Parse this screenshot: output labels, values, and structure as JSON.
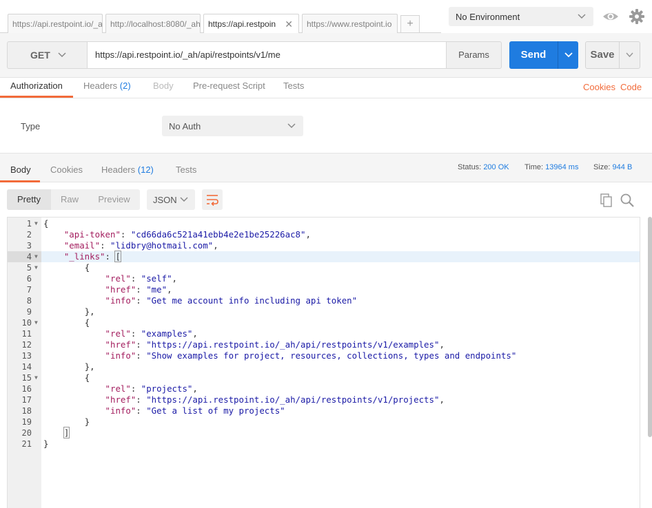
{
  "tabs": [
    {
      "label": "https://api.restpoint.io/_a",
      "active": false
    },
    {
      "label": "http://localhost:8080/_ah",
      "active": false
    },
    {
      "label": "https://api.restpoin",
      "active": true
    },
    {
      "label": "https://www.restpoint.io",
      "active": false
    }
  ],
  "tab_add": "+",
  "environment": {
    "selected": "No Environment"
  },
  "request": {
    "method": "GET",
    "url": "https://api.restpoint.io/_ah/api/restpoints/v1/me",
    "params_label": "Params",
    "send_label": "Send",
    "save_label": "Save"
  },
  "request_tabs": {
    "authorization": "Authorization",
    "headers": "Headers",
    "headers_count": "(2)",
    "body": "Body",
    "prerequest": "Pre-request Script",
    "tests": "Tests",
    "cookies_link": "Cookies",
    "code_link": "Code"
  },
  "auth": {
    "type_label": "Type",
    "type_value": "No Auth"
  },
  "response_tabs": {
    "body": "Body",
    "cookies": "Cookies",
    "headers": "Headers",
    "headers_count": "(12)",
    "tests": "Tests"
  },
  "response_meta": {
    "status_label": "Status:",
    "status_value": "200 OK",
    "time_label": "Time:",
    "time_value": "13964 ms",
    "size_label": "Size:",
    "size_value": "944 B"
  },
  "view": {
    "modes": [
      "Pretty",
      "Raw",
      "Preview"
    ],
    "active_mode": "Pretty",
    "format": "JSON"
  },
  "code_lines": [
    {
      "n": "1",
      "fold": true,
      "text": "{"
    },
    {
      "n": "2",
      "indent": 1,
      "key": "\"api-token\"",
      "value": "\"cd66da6c521a41ebb4e2e1be25226ac8\"",
      "tail": ","
    },
    {
      "n": "3",
      "indent": 1,
      "key": "\"email\"",
      "value": "\"lidbry@hotmail.com\"",
      "tail": ","
    },
    {
      "n": "4",
      "fold": true,
      "hl": true,
      "indent": 1,
      "key": "\"_links\"",
      "open": "["
    },
    {
      "n": "5",
      "fold": true,
      "indent": 2,
      "text": "{"
    },
    {
      "n": "6",
      "indent": 3,
      "key": "\"rel\"",
      "value": "\"self\"",
      "tail": ","
    },
    {
      "n": "7",
      "indent": 3,
      "key": "\"href\"",
      "value": "\"me\"",
      "tail": ","
    },
    {
      "n": "8",
      "indent": 3,
      "key": "\"info\"",
      "value": "\"Get me account info including api token\"",
      "tail": ""
    },
    {
      "n": "9",
      "indent": 2,
      "text": "},"
    },
    {
      "n": "10",
      "fold": true,
      "indent": 2,
      "text": "{"
    },
    {
      "n": "11",
      "indent": 3,
      "key": "\"rel\"",
      "value": "\"examples\"",
      "tail": ","
    },
    {
      "n": "12",
      "indent": 3,
      "key": "\"href\"",
      "value": "\"https://api.restpoint.io/_ah/api/restpoints/v1/examples\"",
      "tail": ","
    },
    {
      "n": "13",
      "indent": 3,
      "key": "\"info\"",
      "value": "\"Show examples for project, resources, collections, types and endpoints\"",
      "tail": ""
    },
    {
      "n": "14",
      "indent": 2,
      "text": "},"
    },
    {
      "n": "15",
      "fold": true,
      "indent": 2,
      "text": "{"
    },
    {
      "n": "16",
      "indent": 3,
      "key": "\"rel\"",
      "value": "\"projects\"",
      "tail": ","
    },
    {
      "n": "17",
      "indent": 3,
      "key": "\"href\"",
      "value": "\"https://api.restpoint.io/_ah/api/restpoints/v1/projects\"",
      "tail": ","
    },
    {
      "n": "18",
      "indent": 3,
      "key": "\"info\"",
      "value": "\"Get a list of my projects\"",
      "tail": ""
    },
    {
      "n": "19",
      "indent": 2,
      "text": "}"
    },
    {
      "n": "20",
      "indent": 1,
      "text": "]",
      "boxed": true
    },
    {
      "n": "21",
      "text": "}"
    }
  ],
  "colors": {
    "accent": "#f26b3a",
    "send": "#1f7ce0",
    "json_key": "#a31d5e",
    "json_string": "#1a1aa6"
  }
}
